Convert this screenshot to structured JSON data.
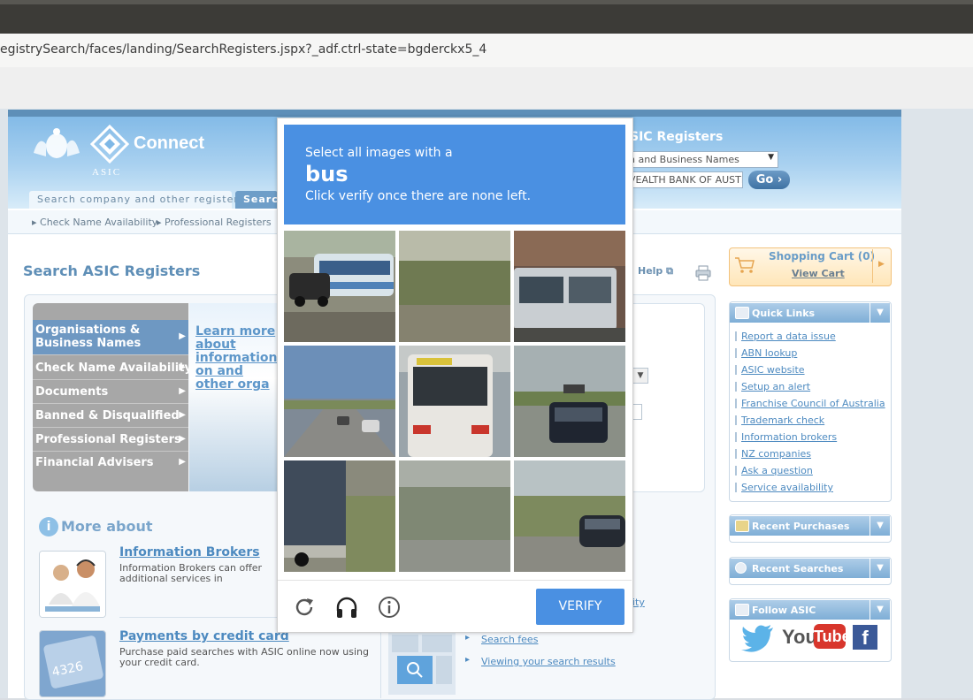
{
  "browser": {
    "url": "egistrySearch/faces/landing/SearchRegisters.jspx?_adf.ctrl-state=bgderckx5_4"
  },
  "header": {
    "connect": "Connect",
    "asic": "ASIC",
    "search_tab": "Search company and other registers",
    "search_tab2": "Search",
    "right_title": "SIC Registers",
    "select_value": "n and Business Names",
    "input_value": "VEALTH BANK OF AUSTI",
    "go": "Go"
  },
  "subnav": {
    "items": [
      "Check Name Availability",
      "Professional Registers"
    ]
  },
  "main": {
    "title": "Search ASIC Registers",
    "help": "Help",
    "menu": [
      "Organisations &",
      "Business Names",
      "Check Name Availability",
      "Documents",
      "Banned & Disqualified",
      "Professional Registers",
      "Financial Advisers"
    ],
    "learn_more": "Learn more about information on and other orga",
    "more_about": "More about",
    "promos": [
      {
        "title": "Information Brokers",
        "text": "Information Brokers can offer additional services in conducting your searches"
      },
      {
        "title": "Payments by credit card",
        "text": "Purchase paid searches with ASIC online now using your credit card."
      }
    ],
    "bottom_links": [
      "Search fees",
      "Viewing your search results"
    ],
    "partial_link": "ity"
  },
  "sidebar": {
    "cart_title": "Shopping Cart (0)",
    "cart_link": "View Cart",
    "quick_links_title": "Quick Links",
    "quick_links": [
      "Report a data issue",
      "ABN lookup",
      "ASIC website",
      "Setup an alert",
      "Franchise Council of Australia",
      "Trademark check",
      "Information brokers",
      "NZ companies",
      "Ask a question",
      "Service availability"
    ],
    "recent_purchases": "Recent Purchases",
    "recent_searches": "Recent Searches",
    "follow": "Follow ASIC",
    "youtube": "You",
    "youtube2": "Tube"
  },
  "captcha": {
    "line1": "Select all images with a",
    "target": "bus",
    "line2": "Click verify once there are none left.",
    "verify": "VERIFY",
    "icons": [
      "reload-icon",
      "audio-icon",
      "info-icon"
    ]
  }
}
